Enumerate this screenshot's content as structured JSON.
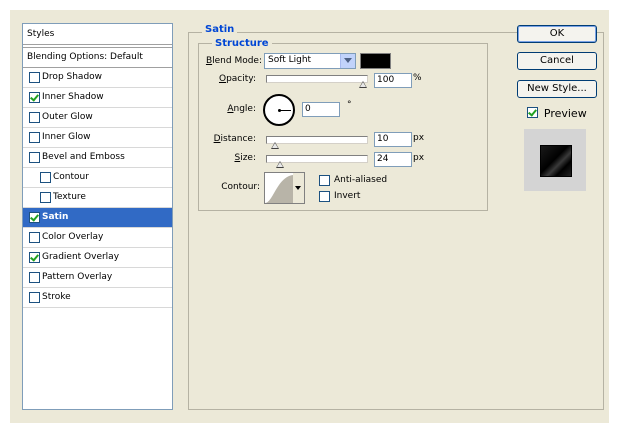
{
  "left_panel": {
    "header": "Styles",
    "blending_options": "Blending Options: Default",
    "items": [
      {
        "label": "Drop Shadow",
        "checked": false,
        "sub": false,
        "selected": false
      },
      {
        "label": "Inner Shadow",
        "checked": true,
        "sub": false,
        "selected": false
      },
      {
        "label": "Outer Glow",
        "checked": false,
        "sub": false,
        "selected": false
      },
      {
        "label": "Inner Glow",
        "checked": false,
        "sub": false,
        "selected": false
      },
      {
        "label": "Bevel and Emboss",
        "checked": false,
        "sub": false,
        "selected": false
      },
      {
        "label": "Contour",
        "checked": false,
        "sub": true,
        "selected": false
      },
      {
        "label": "Texture",
        "checked": false,
        "sub": true,
        "selected": false
      },
      {
        "label": "Satin",
        "checked": true,
        "sub": false,
        "selected": true
      },
      {
        "label": "Color Overlay",
        "checked": false,
        "sub": false,
        "selected": false
      },
      {
        "label": "Gradient Overlay",
        "checked": true,
        "sub": false,
        "selected": false
      },
      {
        "label": "Pattern Overlay",
        "checked": false,
        "sub": false,
        "selected": false
      },
      {
        "label": "Stroke",
        "checked": false,
        "sub": false,
        "selected": false
      }
    ]
  },
  "satin": {
    "title": "Satin",
    "structure_title": "Structure",
    "blend_mode_label": "Blend Mode:",
    "blend_mode_value": "Soft Light",
    "blend_color": "#000000",
    "opacity_label": "Opacity:",
    "opacity_value": "100",
    "opacity_unit": "%",
    "opacity_fraction": 1.0,
    "angle_label": "Angle:",
    "angle_value": "0",
    "angle_unit": "°",
    "distance_label": "Distance:",
    "distance_value": "10",
    "distance_unit": "px",
    "distance_fraction": 0.04,
    "size_label": "Size:",
    "size_value": "24",
    "size_unit": "px",
    "size_fraction": 0.1,
    "contour_label": "Contour:",
    "anti_aliased_label": "Anti-aliased",
    "anti_aliased_checked": false,
    "invert_label": "Invert",
    "invert_checked": false
  },
  "buttons": {
    "ok": "OK",
    "cancel": "Cancel",
    "new_style": "New Style...",
    "preview_label": "Preview",
    "preview_checked": true
  }
}
